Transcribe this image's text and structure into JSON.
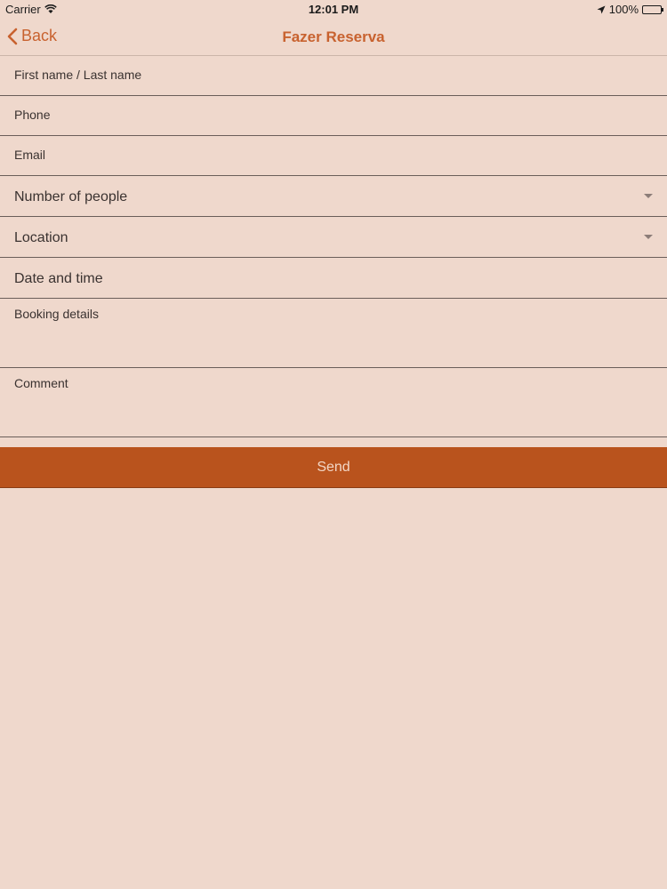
{
  "status_bar": {
    "carrier": "Carrier",
    "time": "12:01 PM",
    "battery": "100%"
  },
  "nav": {
    "back_label": "Back",
    "title": "Fazer Reserva"
  },
  "form": {
    "name_label": "First name / Last name",
    "phone_label": "Phone",
    "email_label": "Email",
    "people_label": "Number of people",
    "location_label": "Location",
    "datetime_label": "Date and time",
    "booking_label": "Booking details",
    "comment_label": "Comment"
  },
  "send_label": "Send",
  "colors": {
    "accent": "#c8622f",
    "button": "#b9531d",
    "background": "#efd8cc"
  }
}
